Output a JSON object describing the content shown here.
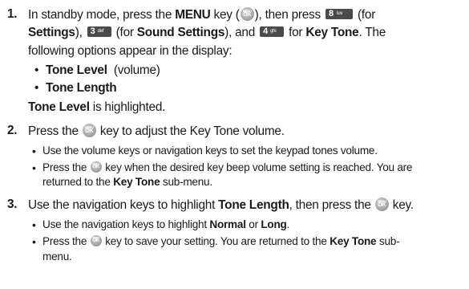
{
  "step1": {
    "num": "1.",
    "l1_a": "In standby mode, press the ",
    "l1_menu": "MENU",
    "l1_b": " key (",
    "l1_c": "), then press ",
    "l1_d": " (for",
    "l2_a": "Settings",
    "l2_b": "), ",
    "l2_c": " (for ",
    "l2_d": "Sound Settings",
    "l2_e": "), and ",
    "l2_f": " for ",
    "l2_g": "Key Tone",
    "l2_h": ". The",
    "l3": "following options appear in the display:",
    "bullet1_bold": "Tone Level",
    "bullet1_rest": "  (volume)",
    "bullet2_bold": "Tone Length",
    "l6_bold": "Tone Level",
    "l6_rest": " is highlighted."
  },
  "keys": {
    "k8": {
      "digit": "8",
      "letters": "tuv"
    },
    "k3": {
      "digit": "3",
      "letters": "def"
    },
    "k4": {
      "digit": "4",
      "letters": "ghi"
    },
    "ok_menu": "MENU",
    "ok_ok": "OK"
  },
  "step2": {
    "num": "2.",
    "main_a": "Press the ",
    "main_b": " key to adjust the Key Tone volume.",
    "sub1": "Use the volume keys or navigation keys to set the keypad tones volume.",
    "sub2_a": "Press the ",
    "sub2_b": " key when the desired key beep volume setting is reached. You are",
    "sub2_c": "returned to the ",
    "sub2_d": "Key Tone",
    "sub2_e": " sub-menu."
  },
  "step3": {
    "num": "3.",
    "main_a": "Use the navigation keys to highlight ",
    "main_b": "Tone Length",
    "main_c": ", then press the ",
    "main_d": " key.",
    "sub1_a": "Use the navigation keys to highlight ",
    "sub1_b": "Normal",
    "sub1_c": " or ",
    "sub1_d": "Long",
    "sub1_e": ".",
    "sub2_a": "Press the ",
    "sub2_b": " key to save your setting. You are returned to the ",
    "sub2_c": "Key Tone",
    "sub2_d": " sub-",
    "sub2_e": "menu."
  },
  "bullet_char": "•"
}
